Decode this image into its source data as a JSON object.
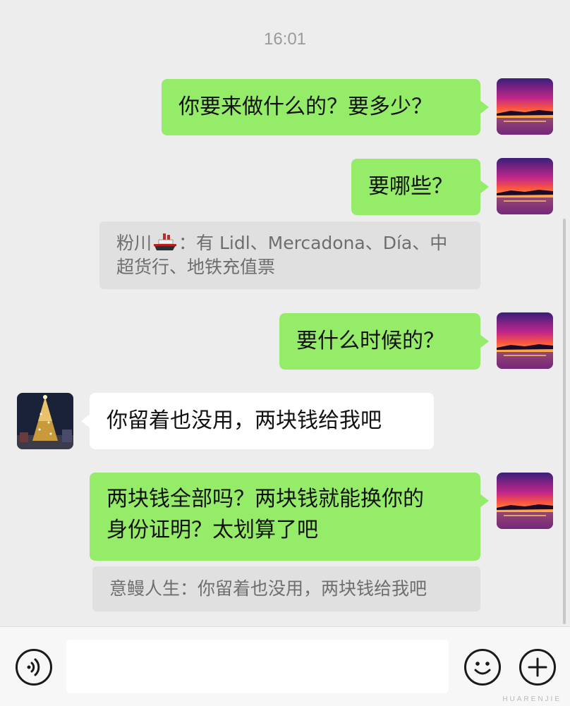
{
  "timestamp": "16:01",
  "messages": [
    {
      "text": "你要来做什么的？要多少？"
    },
    {
      "text": "要哪些？"
    },
    {
      "quote_sender": "粉川",
      "quote_text": "：有 Lidl、Mercadona、Día、中超货行、地铁充值票"
    },
    {
      "text": "要什么时候的？"
    },
    {
      "text": "你留着也没用，两块钱给我吧"
    },
    {
      "text_line1": "两块钱全部吗？两块钱就能换你的",
      "text_line2": "身份证明？太划算了吧"
    },
    {
      "quote_text": "意鳗人生：你留着也没用，两块钱给我吧"
    }
  ],
  "input": {
    "placeholder": ""
  },
  "icons": {
    "voice": "voice-icon",
    "emoji": "emoji-icon",
    "plus": "plus-icon",
    "ship": "ship-emoji-icon"
  },
  "watermark": "HUARENJIE",
  "colors": {
    "background": "#ededed",
    "outgoing_bubble": "#95ec69",
    "incoming_bubble": "#ffffff",
    "quote_bg": "#e0e0e0"
  }
}
